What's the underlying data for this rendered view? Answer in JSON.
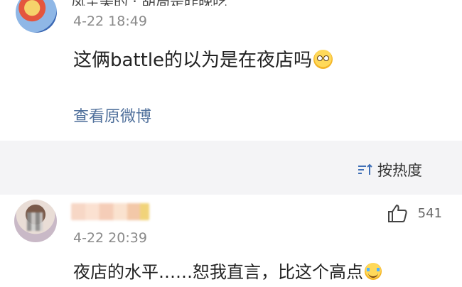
{
  "post": {
    "author_name": "凤尘美的 · 胡局是昨晚吃",
    "timestamp": "4-22 18:49",
    "content": "这俩battle的以为是在夜店吗",
    "content_emoji": "surprised-face-emoji",
    "view_original": "查看原微博"
  },
  "sort": {
    "label": "按热度",
    "icon": "sort-icon"
  },
  "comment": {
    "timestamp": "4-22 20:39",
    "like_count": "541",
    "content": "夜店的水平……恕我直言，比这个高点",
    "content_emoji": "laughing-crying-emoji"
  },
  "colors": {
    "link": "#51719c",
    "secondary_bg": "#f4f4f6",
    "muted_text": "#8a8a8a"
  }
}
